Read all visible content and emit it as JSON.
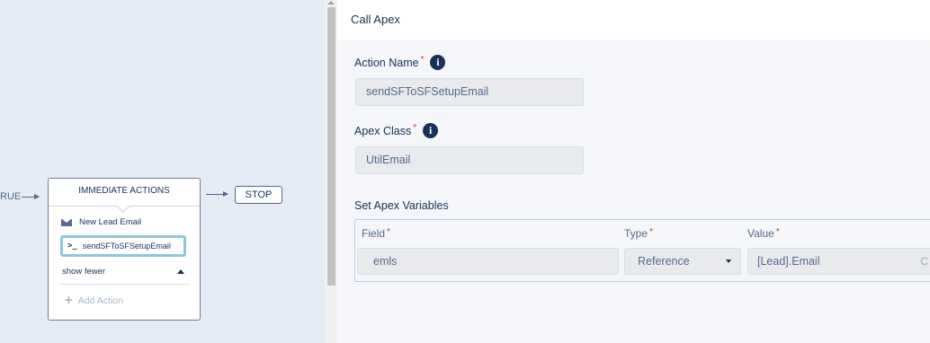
{
  "canvas": {
    "true_label": "RUE",
    "immediate_actions": {
      "header": "IMMEDIATE ACTIONS",
      "actions": [
        {
          "label": "New Lead Email",
          "icon": "email-icon"
        },
        {
          "label": "sendSFToSFSetupEmail",
          "icon": "apex-icon",
          "selected": true
        }
      ],
      "show_fewer": "show fewer",
      "add_action": "Add Action"
    },
    "stop_label": "STOP"
  },
  "panel": {
    "title": "Call Apex",
    "action_name": {
      "label": "Action Name",
      "required": "*",
      "value": "sendSFToSFSetupEmail"
    },
    "apex_class": {
      "label": "Apex Class",
      "required": "*",
      "value": "UtilEmail"
    },
    "apex_vars": {
      "label": "Set Apex Variables",
      "columns": {
        "field": "Field",
        "type": "Type",
        "value": "Value",
        "required": "*"
      },
      "row": {
        "field": "emls",
        "type": "Reference",
        "value": "[Lead].Email"
      }
    }
  },
  "icons": {
    "info": "i",
    "apex_prompt": ">_",
    "plus": "+",
    "lookup": "C"
  },
  "colors": {
    "canvas_bg": "#e4ebf4",
    "panel_bg": "#f4f6f9",
    "text": "#16325c",
    "required": "#c23934",
    "selection": "#8fc6dc"
  }
}
